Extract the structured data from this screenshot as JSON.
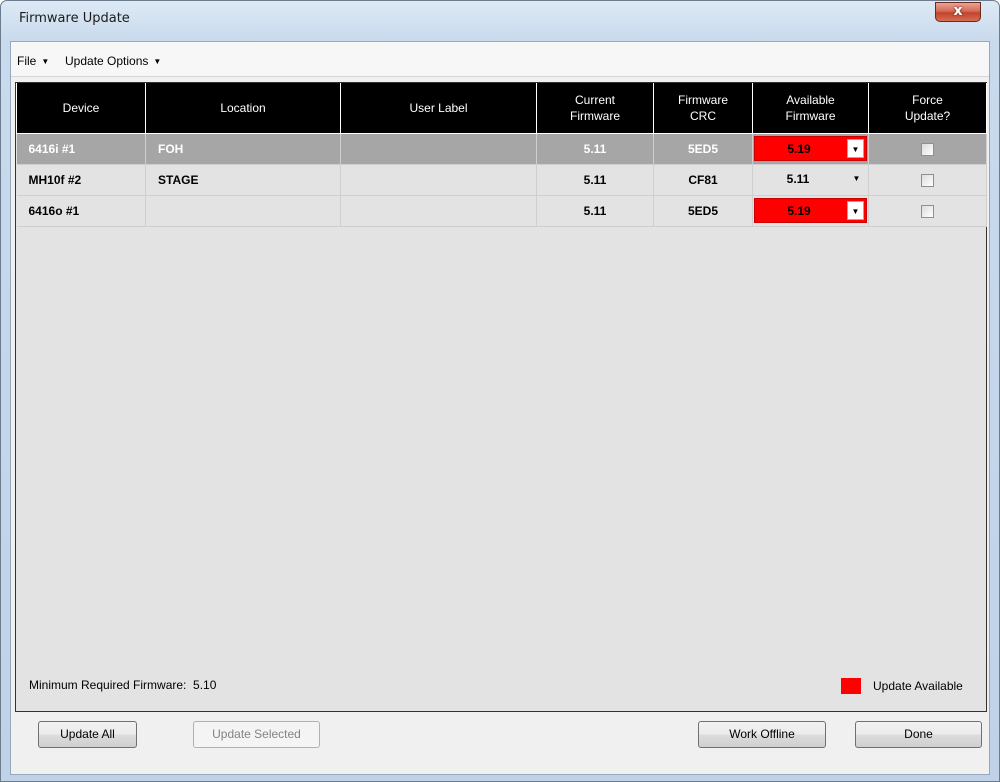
{
  "window": {
    "title": "Firmware Update",
    "close_label": "x"
  },
  "menu": {
    "file": "File",
    "update_options": "Update Options"
  },
  "table": {
    "headers": {
      "device": "Device",
      "location": "Location",
      "user_label": "User Label",
      "current_firmware_1": "Current",
      "current_firmware_2": "Firmware",
      "firmware_crc_1": "Firmware",
      "firmware_crc_2": "CRC",
      "available_firmware_1": "Available",
      "available_firmware_2": "Firmware",
      "force_update_1": "Force",
      "force_update_2": "Update?"
    },
    "rows": [
      {
        "device": "6416i #1",
        "location": "FOH",
        "user_label": "",
        "current": "5.11",
        "crc": "5ED5",
        "available": "5.19",
        "update_available": true,
        "force": false,
        "selected": true
      },
      {
        "device": "MH10f #2",
        "location": "STAGE",
        "user_label": "",
        "current": "5.11",
        "crc": "CF81",
        "available": "5.11",
        "update_available": false,
        "force": false,
        "selected": false
      },
      {
        "device": "6416o #1",
        "location": "",
        "user_label": "",
        "current": "5.11",
        "crc": "5ED5",
        "available": "5.19",
        "update_available": true,
        "force": false,
        "selected": false
      }
    ]
  },
  "status": {
    "min_required": "Minimum Required Firmware:  5.10",
    "legend_label": "Update Available",
    "legend_color": "#ff0000"
  },
  "buttons": {
    "update_all": "Update All",
    "update_selected": "Update Selected",
    "work_offline": "Work Offline",
    "done": "Done"
  }
}
